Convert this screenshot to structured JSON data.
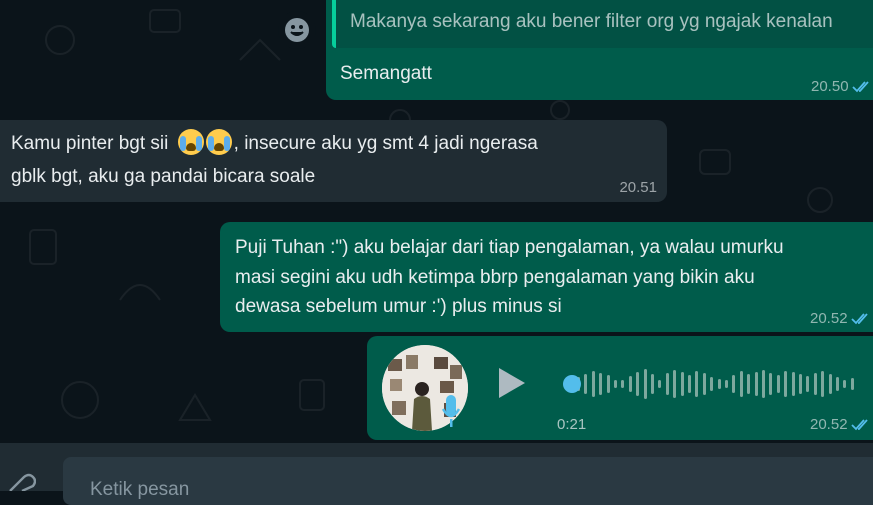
{
  "colors": {
    "background": "#0b141a",
    "outgoing_bubble": "#005c4b",
    "incoming_bubble": "#202c33",
    "quote_bar": "#06cf9c",
    "tick_blue": "#53bdeb"
  },
  "messages": [
    {
      "direction": "outgoing",
      "quoted_text": "Makanya sekarang aku bener filter org yg ngajak kenalan",
      "text": "Semangatt",
      "time": "20.50",
      "status_icon": "double-check-icon"
    },
    {
      "direction": "incoming",
      "text_before_emoji": "Kamu pinter bgt sii",
      "emoji": "loudly-crying-face-emoji",
      "text_after_emoji": ", insecure aku yg smt 4 jadi ngerasa",
      "text_line2": "gblk bgt, aku ga pandai bicara soale",
      "time": "20.51"
    },
    {
      "direction": "outgoing",
      "lines": [
        "Puji Tuhan :\") aku belajar dari tiap pengalaman, ya walau umurku",
        "masi segini aku udh ketimpa bbrp pengalaman yang bikin aku",
        "dewasa sebelum umur :') plus minus si"
      ],
      "time": "20.52",
      "status_icon": "double-check-icon"
    },
    {
      "direction": "outgoing",
      "type": "voice-note",
      "duration": "0:21",
      "progress": 0.0,
      "time": "20.52",
      "status_icon": "double-check-icon"
    }
  ],
  "composer": {
    "placeholder": "Ketik pesan"
  }
}
